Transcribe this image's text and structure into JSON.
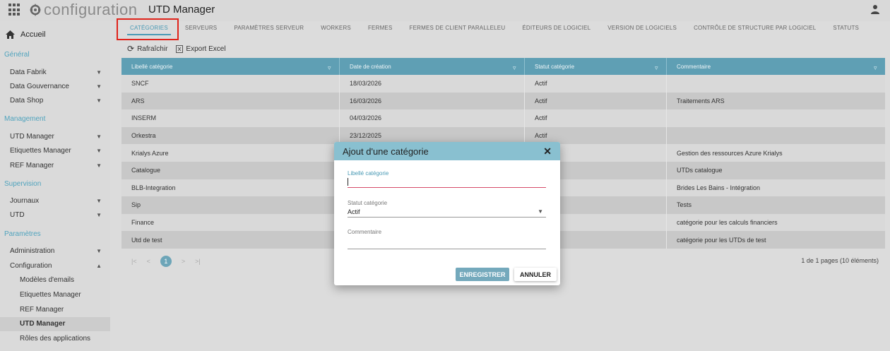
{
  "header": {
    "brand": "configuration",
    "app_title": "UTD Manager"
  },
  "sidebar": {
    "home": "Accueil",
    "sections": [
      {
        "title": "Général",
        "items": [
          "Data Fabrik",
          "Data Gouvernance",
          "Data Shop"
        ]
      },
      {
        "title": "Management",
        "items": [
          "UTD Manager",
          "Etiquettes Manager",
          "REF Manager"
        ]
      },
      {
        "title": "Supervision",
        "items": [
          "Journaux",
          "UTD"
        ]
      },
      {
        "title": "Paramètres",
        "items": [
          "Administration",
          "Configuration"
        ]
      }
    ],
    "subitems": [
      "Modèles d'emails",
      "Etiquettes Manager",
      "REF Manager",
      "UTD Manager",
      "Rôles des applications"
    ]
  },
  "tabs": [
    "CATÉGORIES",
    "SERVEURS",
    "PARAMÈTRES SERVEUR",
    "WORKERS",
    "FERMES",
    "FERMES DE CLIENT PARALLELEU",
    "ÉDITEURS DE LOGICIEL",
    "VERSION DE LOGICIELS",
    "CONTRÔLE DE STRUCTURE PAR LOGICIEL",
    "STATUTS"
  ],
  "toolbar": {
    "refresh": "Rafraîchir",
    "export": "Export Excel"
  },
  "table": {
    "columns": [
      "Libellé catégorie",
      "Date de création",
      "Statut catégorie",
      "Commentaire"
    ],
    "rows": [
      [
        "SNCF",
        "18/03/2026",
        "Actif",
        ""
      ],
      [
        "ARS",
        "16/03/2026",
        "Actif",
        "Traitements ARS"
      ],
      [
        "INSERM",
        "04/03/2026",
        "Actif",
        ""
      ],
      [
        "Orkestra",
        "23/12/2025",
        "Actif",
        ""
      ],
      [
        "Krialys Azure",
        "",
        "",
        "Gestion des ressources Azure Krialys"
      ],
      [
        "Catalogue",
        "",
        "",
        "UTDs catalogue"
      ],
      [
        "BLB-Integration",
        "",
        "",
        "Brides Les Bains - Intégration"
      ],
      [
        "Sip",
        "",
        "",
        "Tests"
      ],
      [
        "Finance",
        "",
        "",
        "catégorie pour les calculs financiers"
      ],
      [
        "Utd de test",
        "",
        "",
        "catégorie pour les UTDs de test"
      ]
    ]
  },
  "pager": {
    "current_page": "1",
    "info": "1 de 1 pages (10 éléments)"
  },
  "modal": {
    "title": "Ajout d'une catégorie",
    "label_field": "Libellé catégorie",
    "label_value": "",
    "status_field": "Statut catégorie",
    "status_value": "Actif",
    "comment_field": "Commentaire",
    "comment_value": "",
    "save": "ENREGISTRER",
    "cancel": "ANNULER"
  },
  "colors": {
    "accent": "#4a9ab5",
    "header_row": "#5f9fb4",
    "modal_header": "#89c0d0",
    "highlight": "#e0231b"
  }
}
